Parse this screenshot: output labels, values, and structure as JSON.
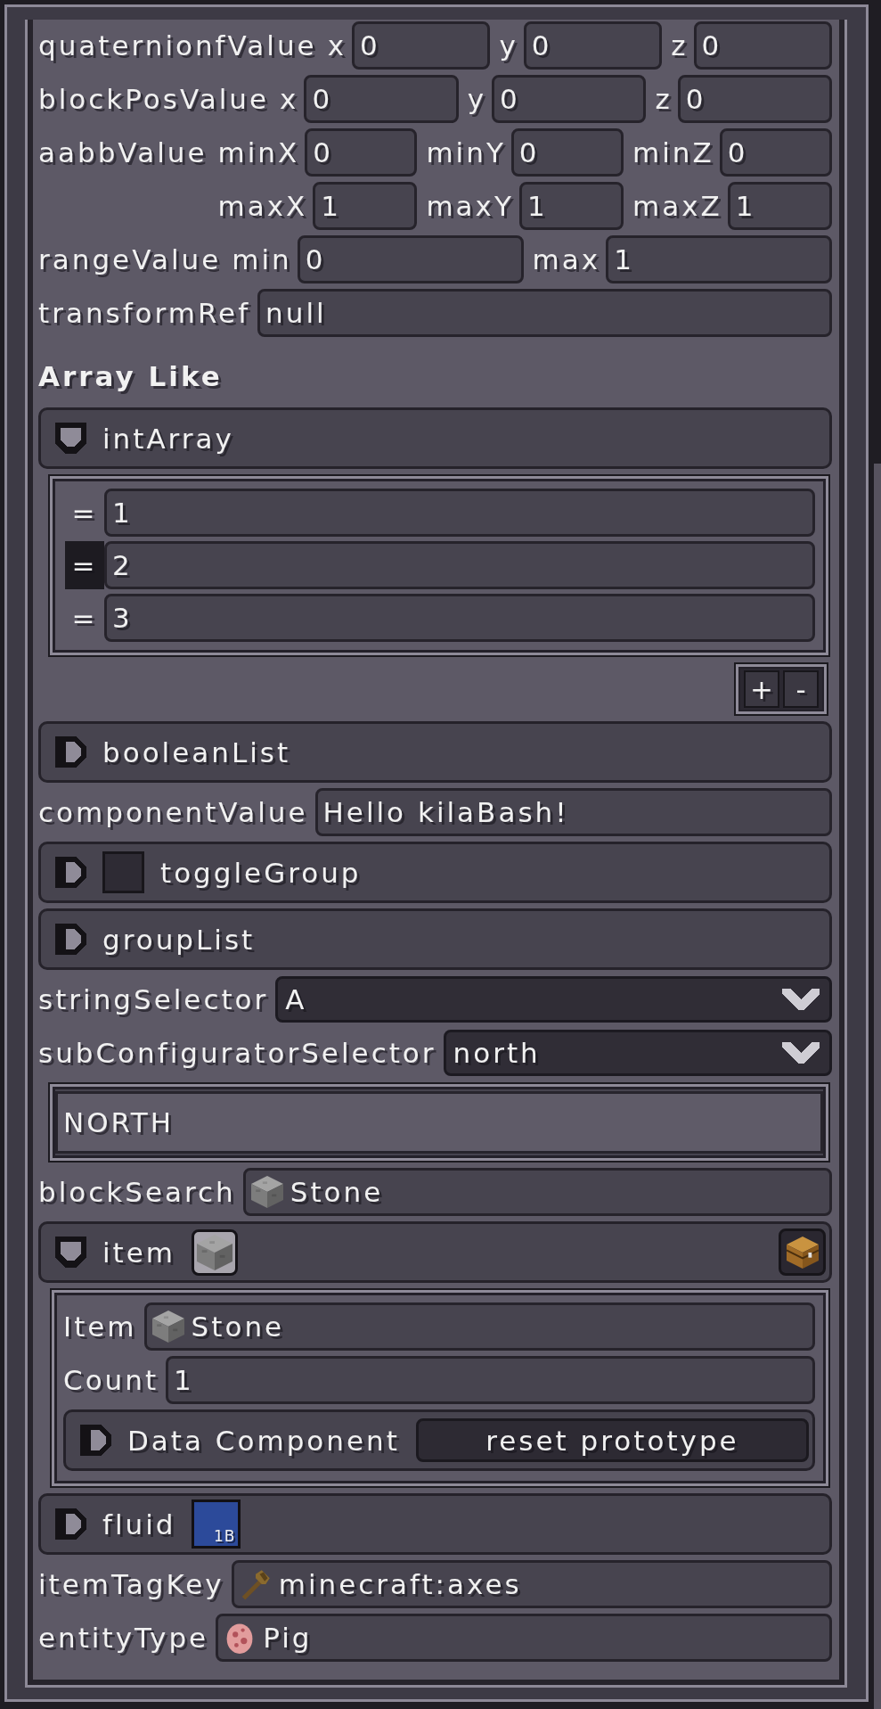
{
  "panel": {
    "entries": [
      {
        "kind": "vector",
        "label": "quaternionfValue",
        "lines": [
          [
            {
              "label": "x",
              "value": "0"
            },
            {
              "label": "y",
              "value": "0"
            },
            {
              "label": "z",
              "value": "0"
            }
          ]
        ]
      },
      {
        "kind": "vector",
        "label": "blockPosValue",
        "lines": [
          [
            {
              "label": "x",
              "value": "0"
            },
            {
              "label": "y",
              "value": "0"
            },
            {
              "label": "z",
              "value": "0"
            }
          ]
        ]
      },
      {
        "kind": "vector",
        "label": "aabbValue",
        "lines": [
          [
            {
              "label": "minX",
              "value": "0"
            },
            {
              "label": "minY",
              "value": "0"
            },
            {
              "label": "minZ",
              "value": "0"
            }
          ],
          [
            {
              "label": "maxX",
              "value": "1"
            },
            {
              "label": "maxY",
              "value": "1"
            },
            {
              "label": "maxZ",
              "value": "1"
            }
          ]
        ]
      },
      {
        "kind": "vector",
        "label": "rangeValue",
        "lines": [
          [
            {
              "label": "min",
              "value": "0"
            },
            {
              "label": "max",
              "value": "1"
            }
          ]
        ]
      },
      {
        "kind": "text",
        "label": "transformRef",
        "value": "null"
      },
      {
        "kind": "heading",
        "text": "Array Like"
      },
      {
        "kind": "list",
        "label": "intArray",
        "expanded": true,
        "items": [
          {
            "handle": "=",
            "value": "1",
            "selected": false
          },
          {
            "handle": "=",
            "value": "2",
            "selected": true
          },
          {
            "handle": "=",
            "value": "3",
            "selected": false
          }
        ],
        "buttons": [
          "+",
          "-"
        ]
      },
      {
        "kind": "group",
        "label": "booleanList",
        "expanded": false
      },
      {
        "kind": "text",
        "label": "componentValue",
        "value": "Hello kilaBash!"
      },
      {
        "kind": "group",
        "label": "toggleGroup",
        "expanded": false,
        "toggle": {
          "checked": false
        }
      },
      {
        "kind": "group",
        "label": "groupList",
        "expanded": false
      },
      {
        "kind": "selector",
        "label": "stringSelector",
        "value": "A"
      },
      {
        "kind": "selector",
        "label": "subConfiguratorSelector",
        "value": "north",
        "detail": "NORTH"
      },
      {
        "kind": "block",
        "label": "blockSearch",
        "value": "Stone"
      },
      {
        "kind": "item",
        "label": "item",
        "expanded": true,
        "children": [
          {
            "kind": "block",
            "label": "Item",
            "value": "Stone"
          },
          {
            "kind": "text",
            "label": "Count",
            "value": "1"
          },
          {
            "kind": "group",
            "label": "Data Component",
            "expanded": false,
            "button": "reset prototype"
          }
        ]
      },
      {
        "kind": "fluid",
        "label": "fluid",
        "expanded": false,
        "amount": "1B"
      },
      {
        "kind": "tag",
        "label": "itemTagKey",
        "value": "minecraft:axes"
      },
      {
        "kind": "entity",
        "label": "entityType",
        "value": "Pig"
      }
    ]
  }
}
